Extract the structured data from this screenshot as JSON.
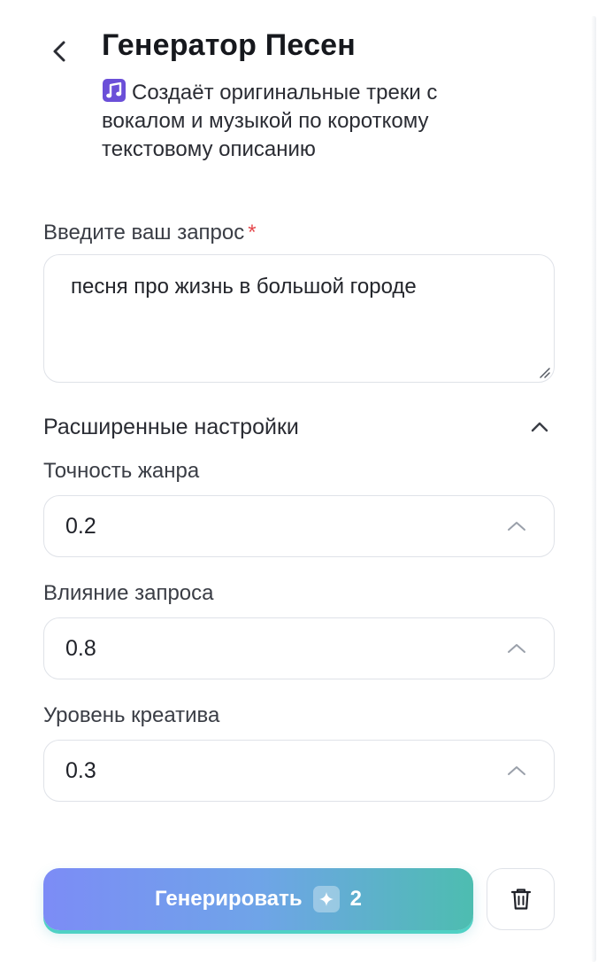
{
  "header": {
    "title": "Генератор Песен",
    "subtitle": "Создаёт оригинальные треки с вокалом и музыкой по короткому текстовому описанию"
  },
  "prompt": {
    "label": "Введите ваш запрос",
    "required_mark": "*",
    "value": "песня про жизнь в большой городе"
  },
  "advanced": {
    "label": "Расширенные настройки",
    "expanded": true,
    "fields": [
      {
        "label": "Точность жанра",
        "value": "0.2"
      },
      {
        "label": "Влияние запроса",
        "value": "0.8"
      },
      {
        "label": "Уровень креатива",
        "value": "0.3"
      }
    ]
  },
  "actions": {
    "generate_label": "Генерировать",
    "cost": "2"
  },
  "icons": {
    "back": "chevron-left-icon",
    "note": "music-note-icon",
    "collapse": "chevron-up-icon",
    "cost": "gem-icon",
    "delete": "trash-icon"
  },
  "colors": {
    "accent_gradient_start": "#7c8cf6",
    "accent_gradient_end": "#4dbdb0",
    "required": "#e5484d",
    "note_icon": "#6b4fd8"
  }
}
